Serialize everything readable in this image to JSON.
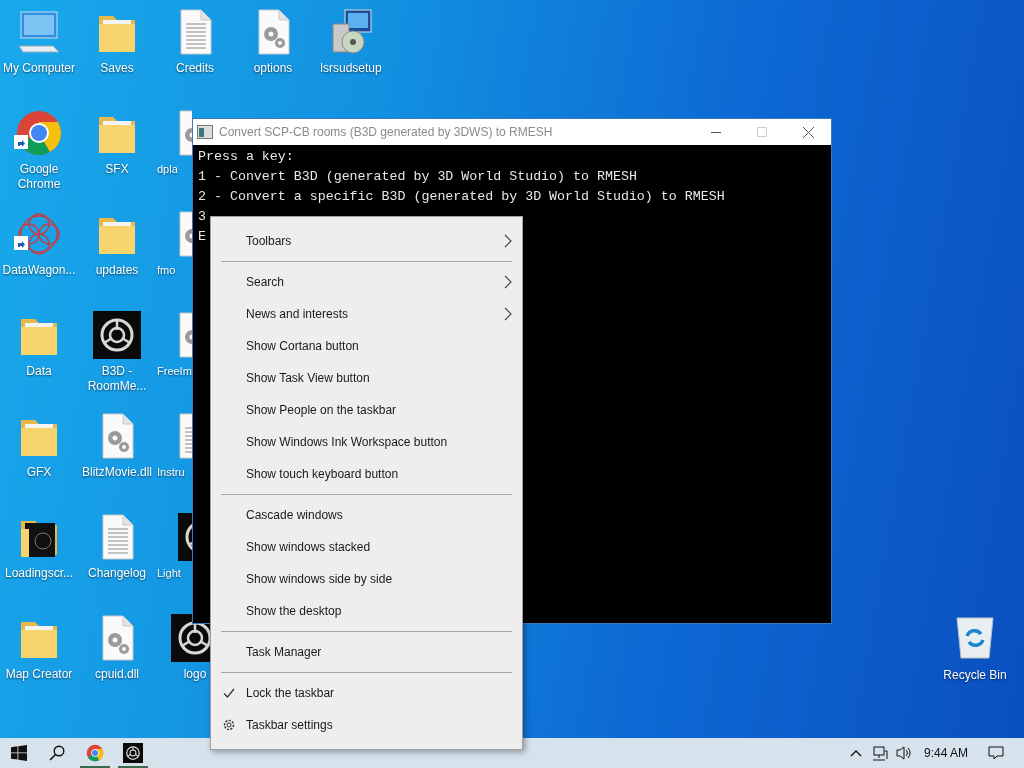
{
  "desktop": {
    "rows": [
      [
        {
          "label": "My Computer",
          "kind": "computer",
          "shortcut": false,
          "cut_off": false
        },
        {
          "label": "Saves",
          "kind": "folder",
          "shortcut": false,
          "cut_off": false
        },
        {
          "label": "Credits",
          "kind": "document",
          "shortcut": false,
          "cut_off": false
        },
        {
          "label": "options",
          "kind": "settings-file",
          "shortcut": false,
          "cut_off": false
        },
        {
          "label": "lsrsudsetup",
          "kind": "installer",
          "shortcut": false,
          "cut_off": false
        }
      ],
      [
        {
          "label": "Google Chrome",
          "kind": "browser",
          "shortcut": true,
          "cut_off": false
        },
        {
          "label": "SFX",
          "kind": "folder",
          "shortcut": false,
          "cut_off": false
        },
        {
          "label": "dpla",
          "kind": "settings-file",
          "shortcut": false,
          "cut_off": true
        }
      ],
      [
        {
          "label": "DataWagon...",
          "kind": "network",
          "shortcut": true,
          "cut_off": false
        },
        {
          "label": "updates",
          "kind": "folder",
          "shortcut": false,
          "cut_off": false
        },
        {
          "label": "fmo",
          "kind": "settings-file",
          "shortcut": false,
          "cut_off": true
        }
      ],
      [
        {
          "label": "Data",
          "kind": "folder",
          "shortcut": false,
          "cut_off": false
        },
        {
          "label": "B3D - RoomMe...",
          "kind": "emblem",
          "shortcut": false,
          "cut_off": false
        },
        {
          "label": "FreeIm",
          "kind": "settings-file",
          "shortcut": false,
          "cut_off": true
        }
      ],
      [
        {
          "label": "GFX",
          "kind": "folder",
          "shortcut": false,
          "cut_off": false
        },
        {
          "label": "BlitzMovie.dll",
          "kind": "settings-file",
          "shortcut": false,
          "cut_off": false
        },
        {
          "label": "Instru",
          "kind": "document",
          "shortcut": false,
          "cut_off": true
        }
      ],
      [
        {
          "label": "Loadingscr...",
          "kind": "dark-folder",
          "shortcut": false,
          "cut_off": false
        },
        {
          "label": "Changelog",
          "kind": "document",
          "shortcut": false,
          "cut_off": false
        },
        {
          "label": "Light",
          "kind": "emblem",
          "shortcut": false,
          "cut_off": true
        }
      ],
      [
        {
          "label": "Map Creator",
          "kind": "folder",
          "shortcut": false,
          "cut_off": false
        },
        {
          "label": "cpuid.dll",
          "kind": "settings-file",
          "shortcut": false,
          "cut_off": false
        },
        {
          "label": "logo",
          "kind": "emblem",
          "shortcut": false,
          "cut_off": false
        }
      ]
    ],
    "recycle_bin": {
      "label": "Recycle Bin"
    }
  },
  "console": {
    "title": "Convert SCP-CB rooms (B3D generated by 3DWS) to RMESH",
    "active": false,
    "lines": [
      "Press a key:",
      "1 - Convert B3D (generated by 3D World Studio) to RMESH",
      "2 - Convert a specific B3D (generated by 3D World Studio) to RMESH",
      "3",
      "E"
    ]
  },
  "context_menu": {
    "groups": [
      [
        {
          "label": "Toolbars",
          "kind": "submenu",
          "checked": false
        }
      ],
      [
        {
          "label": "Search",
          "kind": "submenu",
          "checked": false
        },
        {
          "label": "News and interests",
          "kind": "submenu",
          "checked": false
        },
        {
          "label": "Show Cortana button",
          "kind": "toggle",
          "checked": false
        },
        {
          "label": "Show Task View button",
          "kind": "toggle",
          "checked": false
        },
        {
          "label": "Show People on the taskbar",
          "kind": "toggle",
          "checked": false
        },
        {
          "label": "Show Windows Ink Workspace button",
          "kind": "toggle",
          "checked": false
        },
        {
          "label": "Show touch keyboard button",
          "kind": "toggle",
          "checked": false
        }
      ],
      [
        {
          "label": "Cascade windows",
          "kind": "command",
          "checked": false
        },
        {
          "label": "Show windows stacked",
          "kind": "command",
          "checked": false
        },
        {
          "label": "Show windows side by side",
          "kind": "command",
          "checked": false
        },
        {
          "label": "Show the desktop",
          "kind": "command",
          "checked": false
        }
      ],
      [
        {
          "label": "Task Manager",
          "kind": "command",
          "checked": false
        }
      ],
      [
        {
          "label": "Lock the taskbar",
          "kind": "toggle",
          "checked": true
        },
        {
          "label": "Taskbar settings",
          "kind": "settings",
          "checked": false
        }
      ]
    ]
  },
  "taskbar": {
    "apps": [
      {
        "kind": "start",
        "running": false
      },
      {
        "kind": "search",
        "running": false
      },
      {
        "kind": "browser",
        "running": true
      },
      {
        "kind": "emblem",
        "running": true
      }
    ],
    "clock": "9:44 AM"
  }
}
